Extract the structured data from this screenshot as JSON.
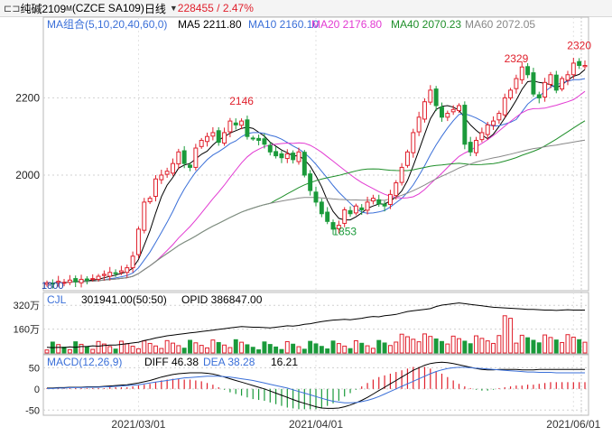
{
  "header": {
    "menu_icon": "collapse-panel-icon",
    "symbol": "纯碱2109",
    "symbol_sup": "M",
    "code": "(CZCE SA109)",
    "period": "日线",
    "last": "2284",
    "change": "55 / 2.47%",
    "colors": {
      "up": "#e0202c",
      "down": "#1a9a3a"
    }
  },
  "legend": {
    "ma_group": "MA组合(5,10,20,40,60,0)",
    "items": [
      {
        "label": "MA5 2211.80",
        "color": "#000000"
      },
      {
        "label": "MA10 2160.10",
        "color": "#3a6fd8"
      },
      {
        "label": "MA20 2176.80",
        "color": "#e23ad2"
      },
      {
        "label": "MA40 2070.23",
        "color": "#1f8f2a"
      },
      {
        "label": "MA60 2072.05",
        "color": "#888888"
      }
    ],
    "vol": {
      "name": "CJL",
      "vol_value": "301941.00(50:50)",
      "opid": "OPID 386847.00"
    },
    "macd": {
      "name": "MACD(12,26,9)",
      "diff": "DIFF 46.38",
      "dea": "DEA 38.28",
      "macd": "16.21"
    }
  },
  "chart_data": {
    "type": "candlestick",
    "ylim": [
      1710,
      2360
    ],
    "price_ticks": [
      "2200",
      "2000"
    ],
    "price_tick_values": [
      2200,
      2000
    ],
    "dates": [
      "2021/03/01",
      "2021/04/01",
      "2021/06/01"
    ],
    "date_indices": [
      16,
      47,
      92
    ],
    "annotations": [
      {
        "text": "2146",
        "idx": 34
      },
      {
        "text": "1853",
        "idx": 52
      },
      {
        "text": "2329",
        "idx": 82
      },
      {
        "text": "2320",
        "idx": 93
      }
    ],
    "bottom_label": "1800",
    "close": [
      1721,
      1719,
      1725,
      1722,
      1728,
      1724,
      1730,
      1727,
      1732,
      1738,
      1743,
      1748,
      1745,
      1752,
      1760,
      1790,
      1860,
      1930,
      1940,
      1990,
      2000,
      2010,
      2030,
      2060,
      2030,
      2020,
      2070,
      2090,
      2100,
      2110,
      2085,
      2110,
      2140,
      2130,
      2140,
      2100,
      2095,
      2090,
      2080,
      2060,
      2050,
      2045,
      2055,
      2040,
      2060,
      2000,
      1960,
      1930,
      1900,
      1880,
      1860,
      1870,
      1910,
      1900,
      1920,
      1910,
      1930,
      1940,
      1925,
      1920,
      1950,
      1980,
      2020,
      2060,
      2110,
      2150,
      2190,
      2220,
      2180,
      2150,
      2160,
      2170,
      2180,
      2080,
      2060,
      2090,
      2110,
      2130,
      2140,
      2160,
      2200,
      2220,
      2250,
      2280,
      2260,
      2210,
      2200,
      2240,
      2260,
      2220,
      2250,
      2260,
      2290,
      2284,
      2284
    ],
    "vol": [
      16,
      15,
      16,
      15,
      17,
      16,
      18,
      18,
      20,
      19,
      21,
      22,
      22,
      24,
      26,
      28,
      30,
      35,
      38,
      42,
      45,
      48,
      50,
      52,
      54,
      56,
      58,
      60,
      62,
      64,
      66,
      68,
      70,
      72,
      74,
      73,
      72,
      72,
      71,
      70,
      72,
      74,
      76,
      75,
      77,
      80,
      82,
      85,
      88,
      90,
      92,
      93,
      94,
      93,
      95,
      97,
      100,
      102,
      101,
      104,
      106,
      108,
      112,
      116,
      118,
      120,
      122,
      124,
      130,
      134,
      136,
      138,
      140,
      138,
      136,
      134,
      132,
      130,
      128,
      127,
      126,
      125,
      124,
      123,
      122,
      122,
      121,
      120,
      120,
      119,
      120,
      121,
      120,
      120,
      120
    ],
    "vol_max": 370,
    "vol_ticks": [
      "320万",
      "160万"
    ],
    "vol_tick_values": [
      320,
      160
    ],
    "macd_ticks": [
      "50",
      "0",
      "-50"
    ],
    "macd_tick_values": [
      50,
      0,
      -50
    ],
    "macd_ylim": [
      -60,
      70
    ],
    "diff": [
      2,
      2,
      3,
      3,
      4,
      4,
      4,
      5,
      5,
      5,
      6,
      7,
      8,
      9,
      10,
      12,
      14,
      17,
      20,
      24,
      28,
      31,
      34,
      36,
      37,
      38,
      38,
      38,
      37,
      35,
      32,
      28,
      24,
      20,
      16,
      12,
      8,
      4,
      0,
      -5,
      -10,
      -15,
      -20,
      -25,
      -30,
      -34,
      -38,
      -42,
      -45,
      -46,
      -46,
      -45,
      -42,
      -38,
      -33,
      -27,
      -20,
      -12,
      -4,
      4,
      12,
      20,
      28,
      36,
      44,
      50,
      56,
      60,
      62,
      63,
      62,
      60,
      57,
      54,
      51,
      48,
      46,
      45,
      45,
      46,
      46,
      46,
      46,
      45,
      45,
      45,
      46,
      46,
      46,
      46,
      46,
      46,
      46,
      46,
      46
    ],
    "dea": [
      1,
      1,
      2,
      2,
      3,
      3,
      3,
      4,
      4,
      4,
      5,
      5,
      6,
      7,
      8,
      9,
      10,
      12,
      14,
      16,
      18,
      20,
      22,
      24,
      26,
      27,
      28,
      29,
      30,
      30,
      30,
      29,
      28,
      26,
      24,
      22,
      20,
      17,
      14,
      11,
      8,
      5,
      2,
      -2,
      -6,
      -10,
      -14,
      -18,
      -22,
      -26,
      -29,
      -31,
      -33,
      -33,
      -32,
      -30,
      -27,
      -23,
      -18,
      -12,
      -6,
      0,
      6,
      12,
      18,
      24,
      30,
      36,
      41,
      45,
      48,
      50,
      51,
      51,
      50,
      49,
      48,
      47,
      46,
      45,
      44,
      43,
      42,
      41,
      40,
      40,
      39,
      39,
      39,
      38,
      38,
      38,
      38,
      38,
      38
    ],
    "macd_bars": [
      2,
      2,
      2,
      2,
      2,
      2,
      2,
      2,
      2,
      2,
      2,
      4,
      4,
      4,
      4,
      6,
      8,
      10,
      12,
      16,
      20,
      22,
      24,
      24,
      22,
      22,
      20,
      18,
      14,
      10,
      4,
      -2,
      -8,
      -12,
      -16,
      -20,
      -24,
      -26,
      -28,
      -32,
      -36,
      -40,
      -44,
      -46,
      -48,
      -48,
      -48,
      -48,
      -46,
      -40,
      -34,
      -28,
      -18,
      -10,
      -2,
      6,
      14,
      22,
      28,
      32,
      36,
      40,
      44,
      48,
      52,
      52,
      52,
      48,
      42,
      36,
      28,
      20,
      12,
      6,
      2,
      -2,
      -4,
      -4,
      -2,
      2,
      4,
      6,
      8,
      8,
      10,
      10,
      12,
      14,
      16,
      16,
      16,
      16,
      16,
      16,
      16
    ]
  }
}
